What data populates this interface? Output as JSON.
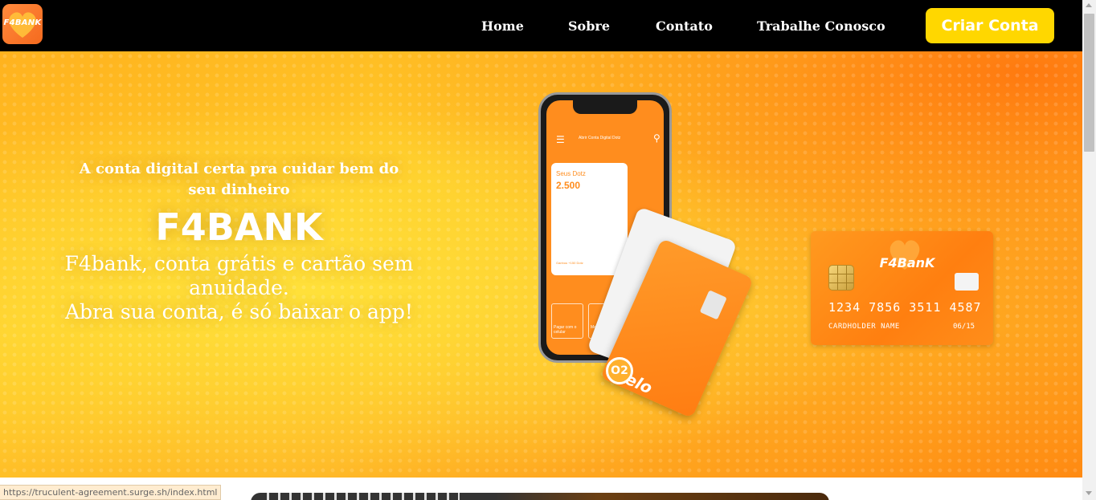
{
  "nav": {
    "logo_text": "F4BANK",
    "links": [
      "Home",
      "Sobre",
      "Contato",
      "Trabalhe Conosco"
    ],
    "cta_label": "Criar Conta",
    "brand_color": "#ffd700"
  },
  "hero": {
    "tagline": "A conta digital certa pra cuidar bem do seu dinheiro",
    "brand": "F4BANK",
    "description_line1": "F4bank, conta grátis e cartão sem anuidade.",
    "description_line2": "Abra sua conta, é só baixar o app!"
  },
  "phone": {
    "header": "Abrir Conta Digital Dotz",
    "dotz_label": "Seus Dotz",
    "dotz_value": "2.500",
    "dotz_footer": "Ganhou +150 Dotz",
    "quick_action_1": "Pagar com o celular",
    "quick_action_2": "Meu",
    "card_brand": "elo",
    "badge": "O2"
  },
  "credit_card": {
    "brand": "F4BanK",
    "number": "1234 7856 3511 4587",
    "holder": "CARDHOLDER NAME",
    "expiry": "06/15"
  },
  "status_bar": {
    "url": "https://truculent-agreement.surge.sh/index.html"
  },
  "icons": [
    "heart-logo-icon",
    "menu-icon",
    "search-icon",
    "chip-icon",
    "contactless-icon",
    "scroll-up-arrow-icon",
    "scroll-down-arrow-icon"
  ]
}
